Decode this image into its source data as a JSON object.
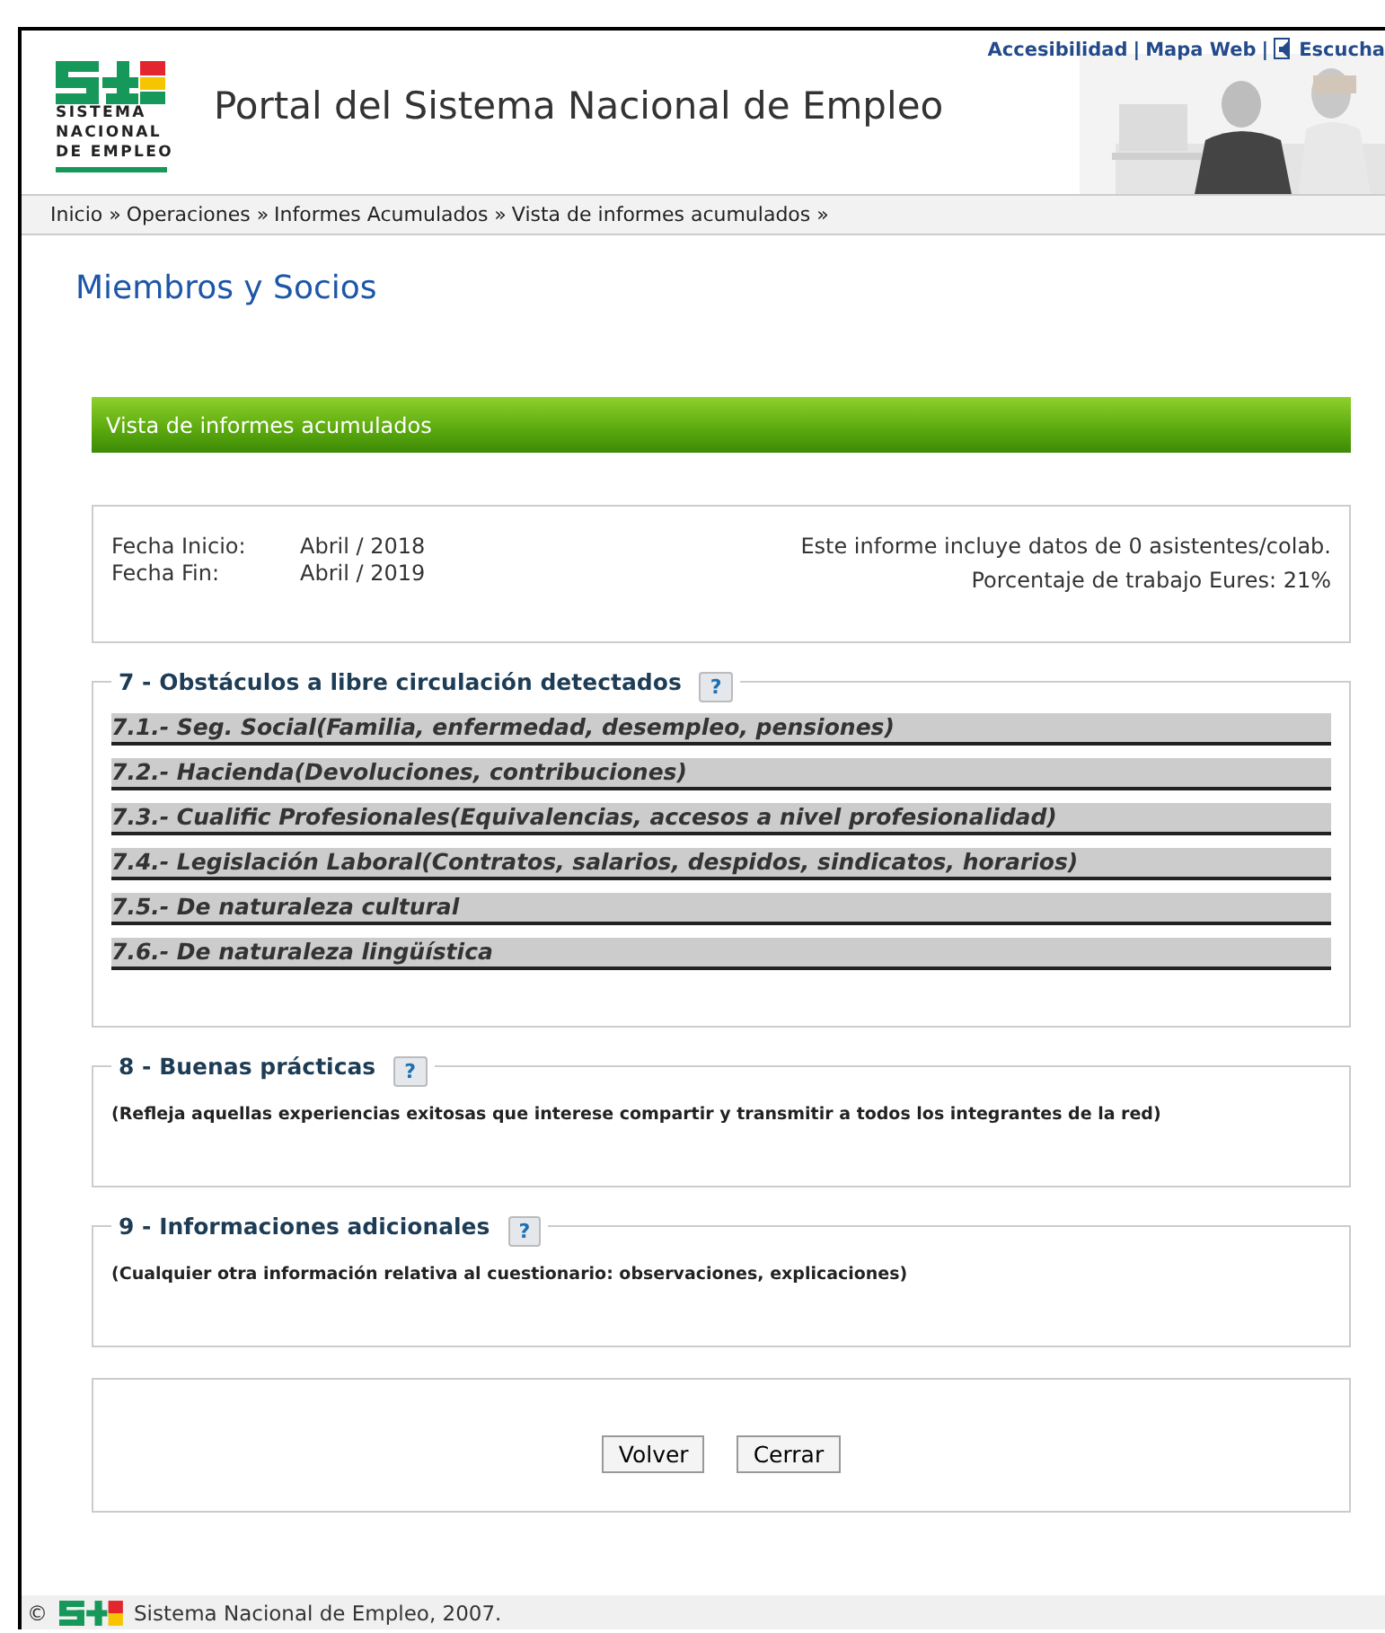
{
  "header": {
    "logo_text": [
      "SISTEMA",
      "NACIONAL",
      "DE EMPLEO"
    ],
    "title": "Portal del Sistema Nacional de Empleo",
    "links": [
      "Accesibilidad",
      "Mapa Web",
      "Escucha"
    ],
    "link_separator": "|"
  },
  "breadcrumb": [
    "Inicio »",
    "Operaciones »",
    "Informes Acumulados »",
    "Vista de informes acumulados »"
  ],
  "page_title": "Miembros y Socios",
  "section_bar": "Vista de informes acumulados",
  "info": {
    "left": [
      {
        "label": "Fecha Inicio:",
        "value": "Abril / 2018"
      },
      {
        "label": "Fecha Fin:",
        "value": "Abril / 2019"
      }
    ],
    "right": [
      "Este informe incluye datos de 0 asistentes/colab.",
      "Porcentaje de trabajo Eures: 21%"
    ]
  },
  "sections": [
    {
      "legend": "7 - Obstáculos a libre circulación detectados",
      "help": "?",
      "items": [
        "7.1.- Seg. Social(Familia, enfermedad, desempleo, pensiones)",
        "7.2.- Hacienda(Devoluciones, contribuciones)",
        "7.3.- Cualific Profesionales(Equivalencias, accesos a nivel profesionalidad)",
        "7.4.- Legislación Laboral(Contratos, salarios, despidos, sindicatos, horarios)",
        "7.5.- De naturaleza cultural",
        "7.6.- De naturaleza lingüística"
      ]
    },
    {
      "legend": "8 - Buenas prácticas",
      "help": "?",
      "note": "(Refleja aquellas experiencias exitosas que interese compartir y transmitir a todos los integrantes de la red)"
    },
    {
      "legend": "9 - Informaciones adicionales",
      "help": "?",
      "note": "(Cualquier otra información relativa al cuestionario: observaciones, explicaciones)"
    }
  ],
  "buttons": [
    "Volver",
    "Cerrar"
  ],
  "footer": {
    "copyright": "©",
    "text": "Sistema Nacional de Empleo, 2007."
  }
}
